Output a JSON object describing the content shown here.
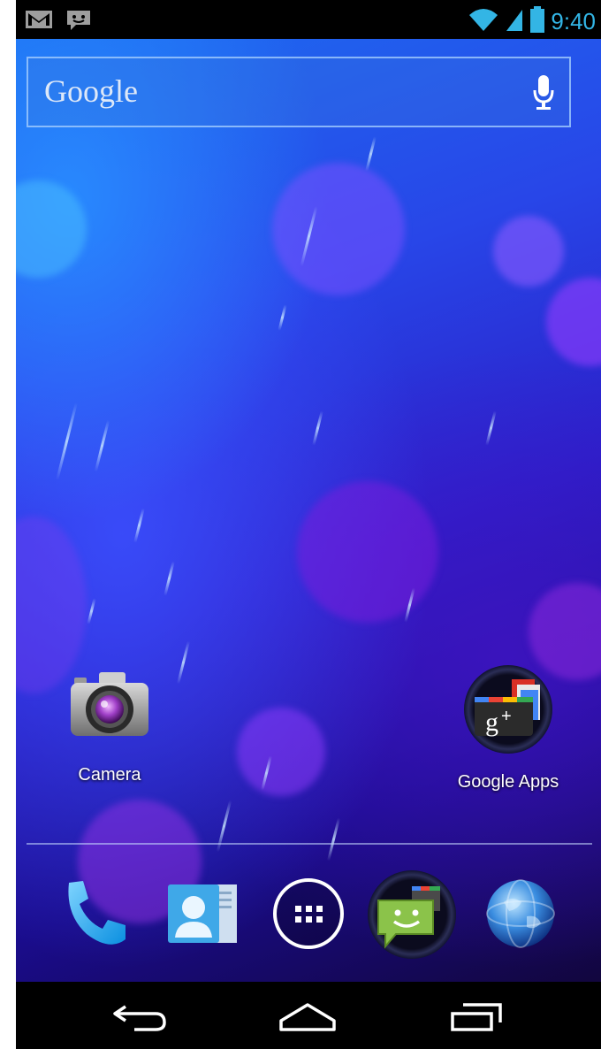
{
  "status_bar": {
    "time": "9:40",
    "notification_icons": [
      "gmail-icon",
      "talk-icon"
    ],
    "system_icons": [
      "wifi-icon",
      "cell-signal-icon",
      "battery-icon"
    ],
    "accent_color": "#33b5e5"
  },
  "search": {
    "label": "Google",
    "voice_icon": "microphone-icon"
  },
  "home_apps": [
    {
      "label": "Camera",
      "icon": "camera-icon"
    },
    {
      "label": "Google Apps",
      "icon": "google-apps-folder-icon"
    }
  ],
  "dock": [
    {
      "icon": "phone-icon"
    },
    {
      "icon": "contacts-icon"
    },
    {
      "icon": "app-drawer-icon"
    },
    {
      "icon": "messaging-folder-icon"
    },
    {
      "icon": "browser-icon"
    }
  ],
  "nav_bar": [
    "back-icon",
    "home-icon",
    "recent-apps-icon"
  ]
}
